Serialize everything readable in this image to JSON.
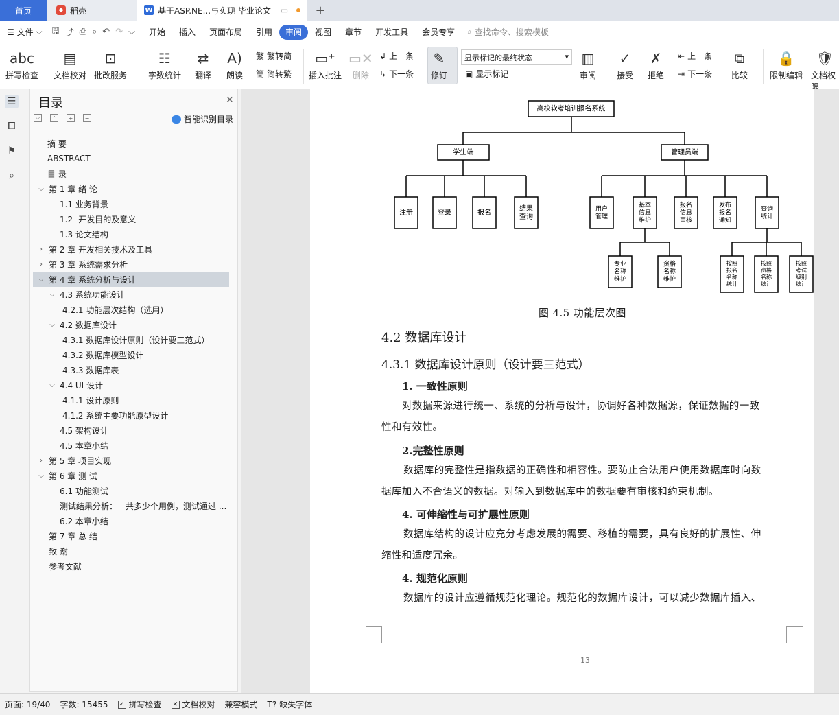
{
  "tabs": {
    "home": "首页",
    "daoke": "稻壳",
    "doc": "基于ASP.NE...与实现 毕业论文"
  },
  "menu": {
    "file": "文件",
    "items": [
      "开始",
      "插入",
      "页面布局",
      "引用",
      "审阅",
      "视图",
      "章节",
      "开发工具",
      "会员专享"
    ],
    "search": "查找命令、搜索模板"
  },
  "ribbon": {
    "spell": "拼写检查",
    "doccheck": "文档校对",
    "approve": "批改服务",
    "wordcount": "字数统计",
    "translate": "翻译",
    "read": "朗读",
    "trad": "繁转简",
    "simp": "简转繁",
    "insert_comment": "插入批注",
    "delete": "删除",
    "prev": "上一条",
    "next": "下一条",
    "revise": "修订",
    "markup_state": "显示标记的最终状态",
    "show_markup": "显示标记",
    "review": "审阅",
    "accept": "接受",
    "reject": "拒绝",
    "prev2": "上一条",
    "next2": "下一条",
    "compare": "比较",
    "restrict": "限制编辑",
    "docperm": "文档权限"
  },
  "toc": {
    "title": "目录",
    "smart": "智能识别目录",
    "items": [
      "摘 要",
      "ABSTRACT",
      "目 录",
      "第 1 章 绪 论",
      "1.1 业务背景",
      "1.2 -开发目的及意义",
      "1.3 论文结构",
      "第 2 章 开发相关技术及工具",
      "第 3 章 系统需求分析",
      "第 4 章 系统分析与设计",
      "4.3 系统功能设计",
      "4.2.1 功能层次结构（选用）",
      "4.2 数据库设计",
      "4.3.1 数据库设计原则（设计要三范式）",
      "4.3.2 数据库模型设计",
      "4.3.3 数据库表",
      "4.4 UI 设计",
      "4.1.1 设计原则",
      "4.1.2 系统主要功能原型设计",
      "4.5 架构设计",
      "4.5 本章小结",
      "第 5 章 项目实现",
      "第 6 章 测 试",
      "6.1 功能测试",
      "测试结果分析：一共多少个用例，测试通过 ...",
      "6.2 本章小结",
      "第 7 章 总 结",
      "致 谢",
      "参考文献"
    ]
  },
  "diagram": {
    "root": "高校软考培训报名系统",
    "student": "学生端",
    "admin": "管理员端",
    "s_children": [
      "注册",
      "登录",
      "报名",
      "结果\n查询"
    ],
    "a_children": [
      "用户\n管理",
      "基本\n信息\n维护",
      "报名\n信息\n审核",
      "发布\n报名\n通知",
      "查询\n统计"
    ],
    "basic_children": [
      "专业\n名称\n维护",
      "资格\n名称\n维护"
    ],
    "query_children": [
      "按照\n报名\n名称\n统计",
      "按照\n资格\n名称\n统计",
      "按照\n考试\n级别\n统计"
    ],
    "caption": "图 4.5 功能层次图"
  },
  "doc": {
    "h42": "4.2 数据库设计",
    "h431": "4.3.1 数据库设计原则（设计要三范式）",
    "b1": "1. 一致性原则",
    "t1a": "对数据来源进行统一、系统的分析与设计，协调好各种数据源，保证数据的一致",
    "t1b": "性和有效性。",
    "b2": "2.完整性原则",
    "t2a": "数据库的完整性是指数据的正确性和相容性。要防止合法用户使用数据库时向数",
    "t2b": "据库加入不合语义的数据。对输入到数据库中的数据要有审核和约束机制。",
    "b3": "4. 可伸缩性与可扩展性原则",
    "t3a": "数据库结构的设计应充分考虑发展的需要、移植的需要，具有良好的扩展性、伸",
    "t3b": "缩性和适度冗余。",
    "b4": "4. 规范化原则",
    "t4a": "数据库的设计应遵循规范化理论。规范化的数据库设计，可以减少数据库插入、",
    "pagenum": "13"
  },
  "status": {
    "page": "页面: 19/40",
    "words": "字数: 15455",
    "spell": "拼写检查",
    "check": "文档校对",
    "compat": "兼容模式",
    "font": "缺失字体"
  }
}
